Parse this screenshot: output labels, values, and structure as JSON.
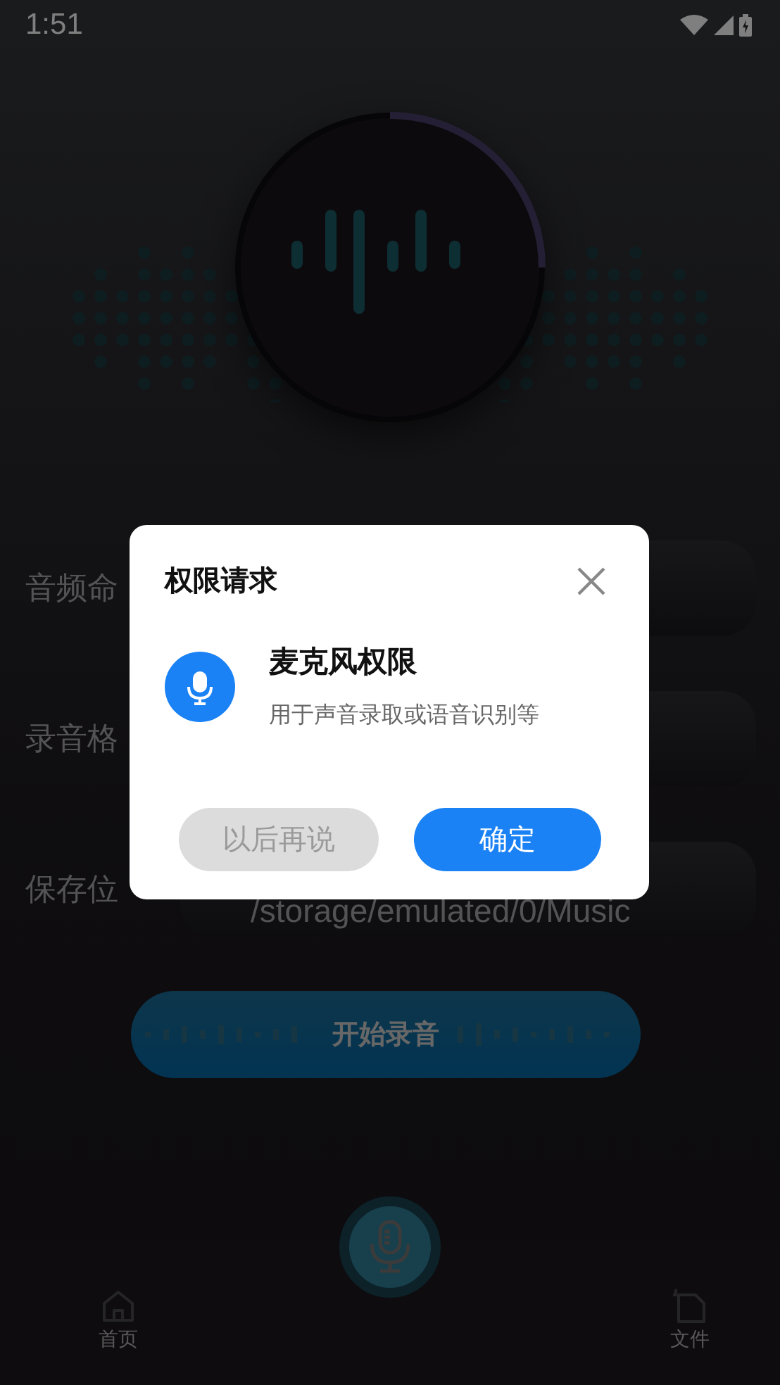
{
  "status_bar": {
    "time": "1:51"
  },
  "recorder": {
    "level": 0.25
  },
  "form": [
    {
      "label": "音频命"
    },
    {
      "label": "录音格"
    },
    {
      "label": "保存位",
      "value": "/storage/emulated/0/Music"
    }
  ],
  "start_button": {
    "label": "开始录音"
  },
  "bottom_nav": [
    {
      "kind": "home",
      "label": "首页"
    },
    {
      "kind": "file",
      "label": "文件"
    }
  ],
  "dialog": {
    "title": "权限请求",
    "permission_title": "麦克风权限",
    "permission_desc": "用于声音录取或语音识别等",
    "buttons": [
      {
        "kind": "secondary",
        "label": "以后再说"
      },
      {
        "kind": "primary",
        "label": "确定"
      }
    ]
  }
}
